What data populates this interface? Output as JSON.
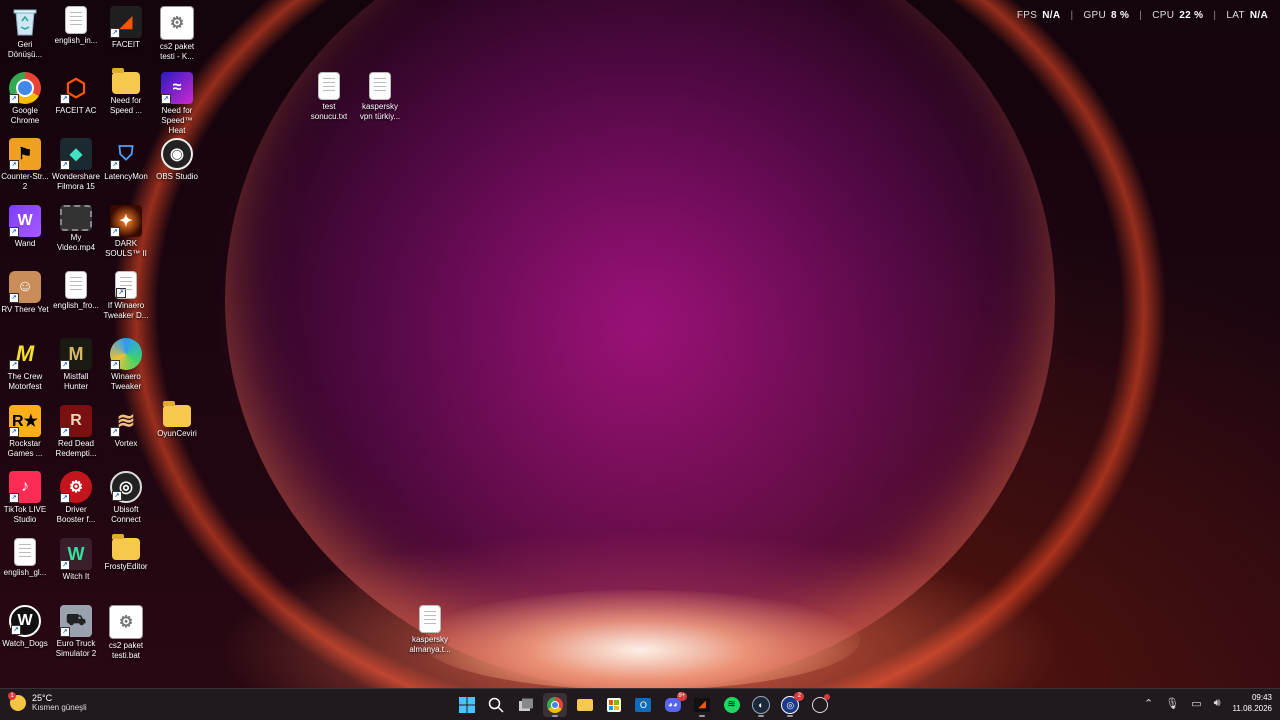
{
  "overlay": {
    "fps_label": "FPS",
    "fps_value": "N/A",
    "gpu_label": "GPU",
    "gpu_value": "8 %",
    "cpu_label": "CPU",
    "cpu_value": "22 %",
    "lat_label": "LAT",
    "lat_value": "N/A"
  },
  "desktop": {
    "icons": [
      {
        "label": "Geri Dönüşü...",
        "icon": "recycle-bin-icon"
      },
      {
        "label": "english_in...",
        "icon": "file-icon"
      },
      {
        "label": "FACEIT",
        "icon": "faceit-icon"
      },
      {
        "label": "cs2 paket testi - K...",
        "icon": "bat-file-icon"
      },
      {
        "label": "Google Chrome",
        "icon": "chrome-icon"
      },
      {
        "label": "FACEIT AC",
        "icon": "faceit-ac-icon"
      },
      {
        "label": "Need for Speed ...",
        "icon": "folder-icon"
      },
      {
        "label": "Need for Speed™ Heat",
        "icon": "nfs-heat-icon"
      },
      {
        "label": "Counter-Str... 2",
        "icon": "cs2-icon"
      },
      {
        "label": "Wondershare Filmora 15",
        "icon": "filmora-icon"
      },
      {
        "label": "LatencyMon",
        "icon": "latencymon-icon"
      },
      {
        "label": "OBS Studio",
        "icon": "obs-icon"
      },
      {
        "label": "Wand",
        "icon": "wand-icon"
      },
      {
        "label": "My Video.mp4",
        "icon": "video-file-icon"
      },
      {
        "label": "DARK SOULS™ II",
        "icon": "dark-souls-icon"
      },
      {
        "label": "RV There Yet",
        "icon": "rv-there-yet-icon"
      },
      {
        "label": "english_fro...",
        "icon": "file-icon"
      },
      {
        "label": "If Winaero Tweaker D...",
        "icon": "file-icon"
      },
      {
        "label": "The Crew Motorfest",
        "icon": "the-crew-icon"
      },
      {
        "label": "Mistfall Hunter",
        "icon": "mistfall-icon"
      },
      {
        "label": "Winaero Tweaker",
        "icon": "winaero-icon"
      },
      {
        "label": "Rockstar Games ...",
        "icon": "rockstar-icon"
      },
      {
        "label": "Red Dead Redempti...",
        "icon": "rdr-icon"
      },
      {
        "label": "Vortex",
        "icon": "vortex-icon"
      },
      {
        "label": "OyunCeviri",
        "icon": "folder-icon"
      },
      {
        "label": "TikTok LIVE Studio",
        "icon": "tiktok-icon"
      },
      {
        "label": "Driver Booster f...",
        "icon": "driver-booster-icon"
      },
      {
        "label": "Ubisoft Connect",
        "icon": "ubisoft-icon"
      },
      {
        "label": "english_gl...",
        "icon": "file-icon"
      },
      {
        "label": "Witch It",
        "icon": "witch-it-icon"
      },
      {
        "label": "FrostyEditor",
        "icon": "folder-icon"
      },
      {
        "label": "Watch_Dogs",
        "icon": "watch-dogs-icon"
      },
      {
        "label": "Euro Truck Simulator 2",
        "icon": "ets2-icon"
      },
      {
        "label": "cs2 paket testi.bat",
        "icon": "bat-file-icon"
      },
      {
        "label": "test sonucu.txt",
        "icon": "file-icon"
      },
      {
        "label": "kaspersky vpn türkiy...",
        "icon": "file-icon"
      },
      {
        "label": "kaspersky almanya.t...",
        "icon": "file-icon"
      }
    ]
  },
  "taskbar": {
    "weather_temp": "25°C",
    "weather_desc": "Kısmen güneşli",
    "weather_badge": "1",
    "discord_badge": "9+",
    "ubisoft_badge": "2",
    "time": "09:43",
    "date": "11.08.2026",
    "apps": [
      "windows-start-icon",
      "search-icon",
      "task-view-icon",
      "chrome-icon",
      "file-explorer-icon",
      "microsoft-store-icon",
      "outlook-icon",
      "discord-icon",
      "faceit-icon",
      "spotify-icon",
      "steam-icon",
      "ubisoft-icon",
      "app-icon"
    ]
  }
}
